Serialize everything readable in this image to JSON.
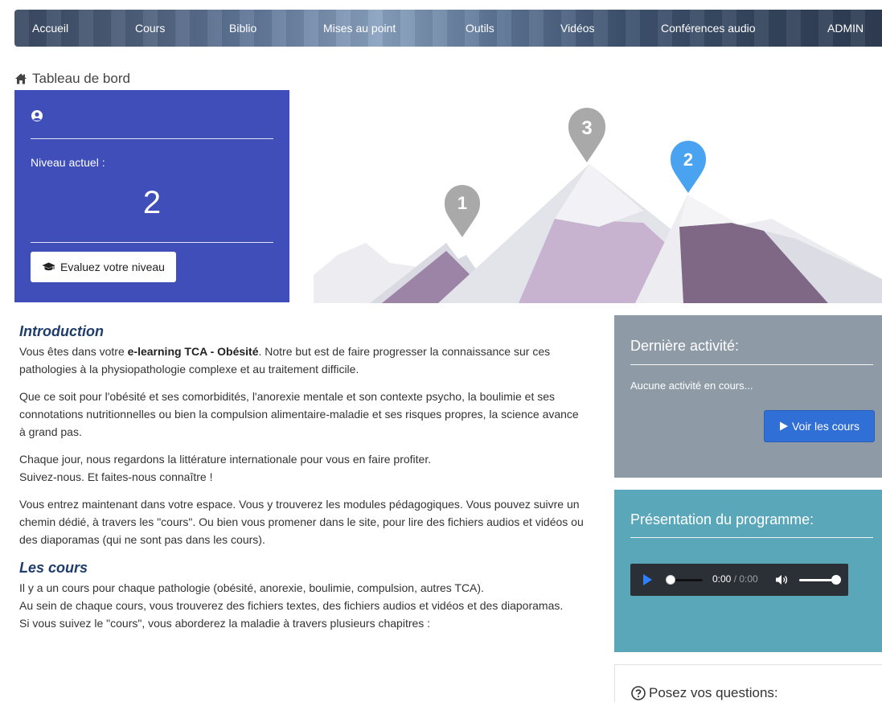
{
  "nav": {
    "items": [
      "Accueil",
      "Cours",
      "Biblio",
      "Mises au point",
      "Outils",
      "Vidéos",
      "Conférences audio",
      "ADMIN"
    ]
  },
  "breadcrumb": {
    "label": "Tableau de bord",
    "icon": "home-icon"
  },
  "level_card": {
    "level_label": "Niveau actuel :",
    "level_value": "2",
    "eval_button": "Evaluez votre niveau",
    "color": "#3f4eb8"
  },
  "illustration": {
    "markers": [
      "1",
      "3",
      "2"
    ],
    "active_marker": "2",
    "active_color": "#4aa3f0",
    "inactive_color": "#a9a9a9"
  },
  "intro": {
    "heading": "Introduction",
    "p1_before": "Vous êtes dans votre ",
    "p1_bold": "e-learning TCA - Obésité",
    "p1_after": ". Notre but est de faire progresser la connaissance sur ces pathologies à la physiopathologie complexe et au traitement difficile.",
    "p2": "Que ce soit pour l'obésité et ses comorbidités, l'anorexie mentale et son contexte psycho, la boulimie et ses connotations nutritionnelles ou bien la compulsion alimentaire-maladie et ses risques propres, la science avance à grand pas.",
    "p3_line1": "Chaque jour, nous regardons la littérature internationale pour vous en faire profiter.",
    "p3_line2": "Suivez-nous. Et faites-nous connaître !",
    "p4": "Vous entrez maintenant dans votre espace. Vous y trouverez les modules pédagogiques. Vous pouvez suivre un chemin dédié, à travers les \"cours\". Ou bien vous promener dans le site, pour lire des fichiers audios et vidéos ou des diaporamas (qui ne sont pas dans les cours)."
  },
  "cours": {
    "heading": "Les cours",
    "line1": "Il y a un cours pour chaque pathologie (obésité, anorexie, boulimie, compulsion, autres TCA).",
    "line2": "Au sein de chaque cours, vous trouverez des fichiers textes, des fichiers audios et vidéos et des diaporamas.",
    "line3": "Si vous suivez le \"cours\", vous aborderez la maladie à travers plusieurs chapitres :"
  },
  "last_activity": {
    "title": "Dernière activité:",
    "text": "Aucune activité en cours...",
    "button": "Voir les cours",
    "color": "#8e9ba7"
  },
  "program": {
    "title": "Présentation du programme:",
    "time_current": "0:00",
    "time_separator": " / ",
    "time_total": "0:00",
    "color": "#5ba7ba"
  },
  "questions": {
    "title": "Posez vos questions:"
  }
}
